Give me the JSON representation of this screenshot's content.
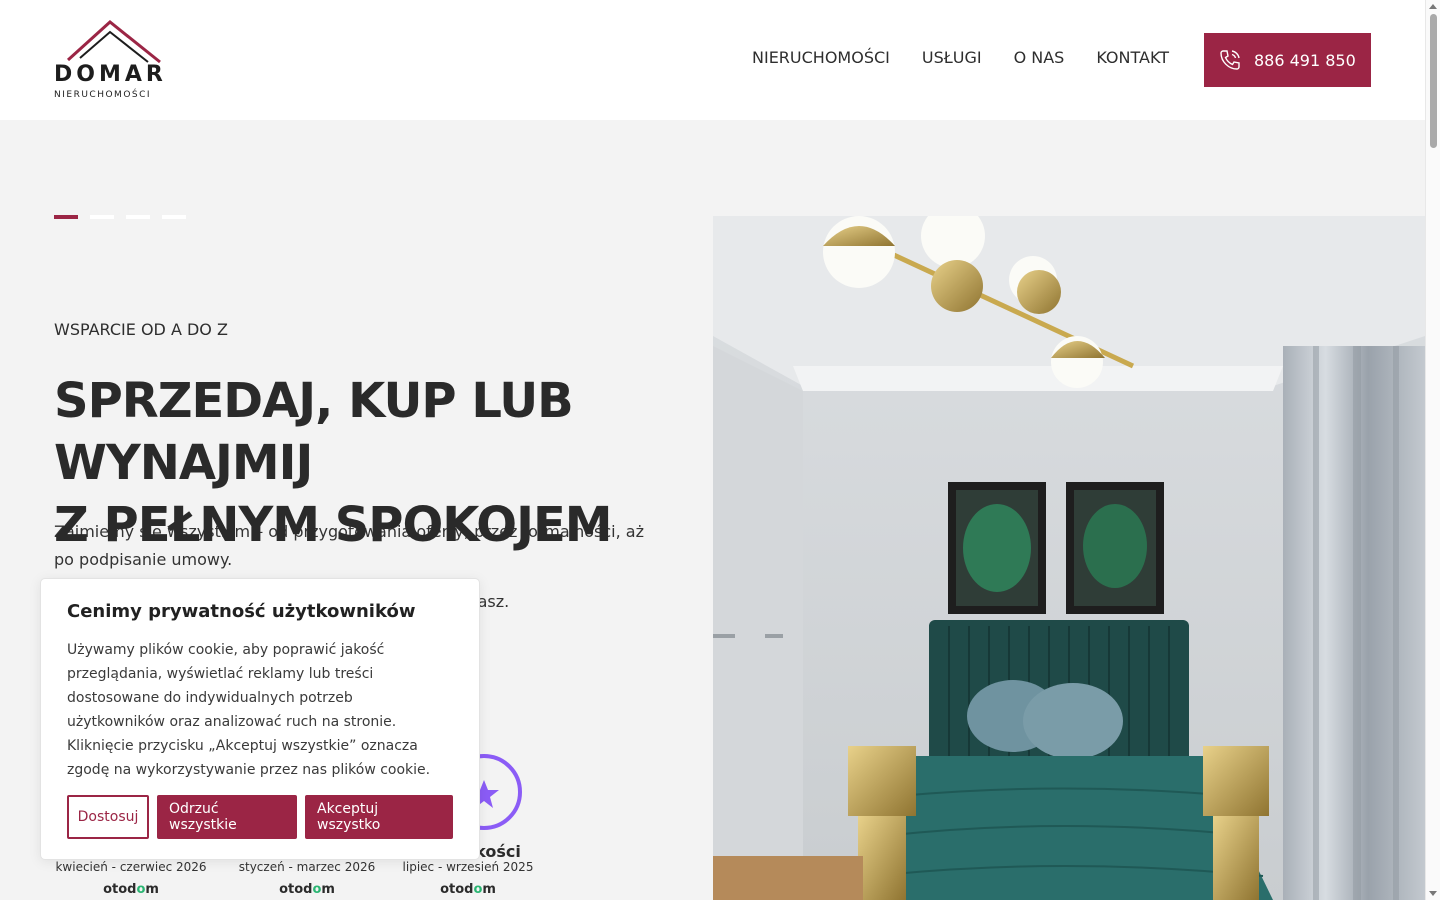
{
  "header": {
    "logo_name": "DOMAR",
    "logo_sub": "NIERUCHOMOŚCI",
    "nav": [
      "NIERUCHOMOŚCI",
      "USŁUGI",
      "O NAS",
      "KONTAKT"
    ],
    "phone": "886 491 850"
  },
  "hero": {
    "eyebrow": "WSPARCIE OD A DO Z",
    "title_line1": "SPRZEDAJ, KUP LUB WYNAJMIJ",
    "title_line2": "Z PEŁNYM SPOKOJEM",
    "desc": "Zajmiemy się wszystkim – od przygotowania oferty, przez formalności, aż po podpisanie umowy.",
    "desc2_visible": "aufasz."
  },
  "badges": [
    {
      "date": "kwiecień - czerwiec  2026",
      "brand_pre": "otod",
      "brand_o": "o",
      "brand_post": "m"
    },
    {
      "date": "styczeń - marzec  2026",
      "brand_pre": "otod",
      "brand_o": "o",
      "brand_post": "m"
    },
    {
      "title_visible": "kości",
      "date": "lipiec - wrzesień  2025",
      "brand_pre": "otod",
      "brand_o": "o",
      "brand_post": "m"
    }
  ],
  "cookie": {
    "title": "Cenimy prywatność użytkowników",
    "text": "Używamy plików cookie, aby poprawić jakość przeglądania, wyświetlać reklamy lub treści dostosowane do indywidualnych potrzeb użytkowników oraz analizować ruch na stronie. Kliknięcie przycisku „Akceptuj wszystkie” oznacza zgodę na wykorzystywanie przez nas plików cookie.",
    "btn_customize": "Dostosuj",
    "btn_reject": "Odrzuć wszystkie",
    "btn_accept": "Akceptuj wszystko"
  },
  "colors": {
    "accent": "#9b2545",
    "background": "#f3f3f3"
  }
}
